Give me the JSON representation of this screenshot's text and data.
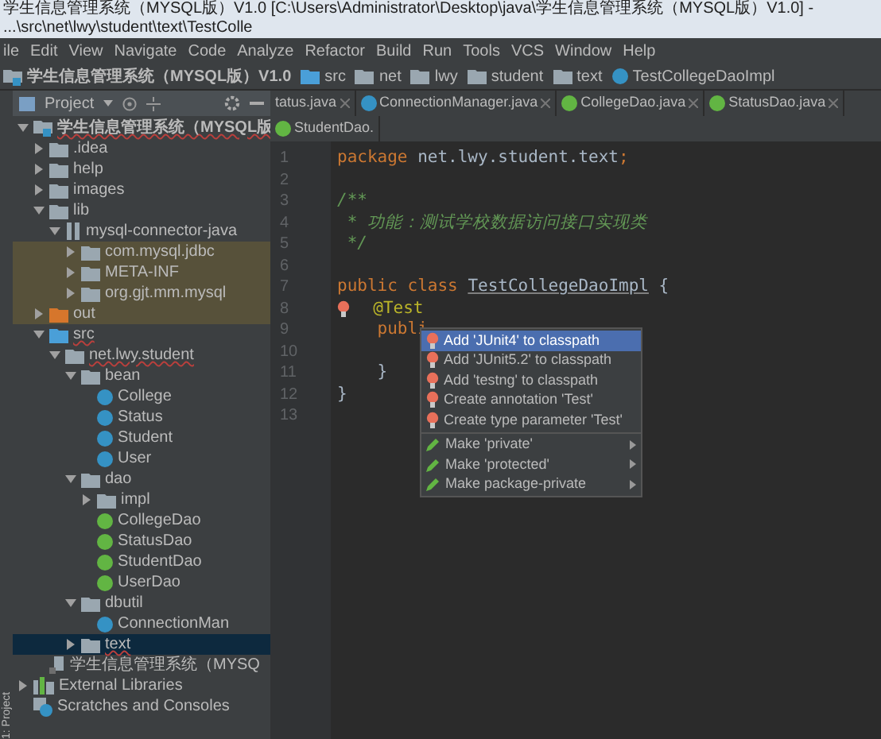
{
  "window": {
    "title": "学生信息管理系统（MYSQL版）V1.0 [C:\\Users\\Administrator\\Desktop\\java\\学生信息管理系统（MYSQL版）V1.0] - ...\\src\\net\\lwy\\student\\text\\TestColle"
  },
  "menu": [
    "ile",
    "Edit",
    "View",
    "Navigate",
    "Code",
    "Analyze",
    "Refactor",
    "Build",
    "Run",
    "Tools",
    "VCS",
    "Window",
    "Help"
  ],
  "breadcrumb": [
    {
      "text": "学生信息管理系统（MYSQL版）V1.0",
      "kind": "project"
    },
    {
      "text": "src",
      "kind": "source-folder"
    },
    {
      "text": "net",
      "kind": "folder"
    },
    {
      "text": "lwy",
      "kind": "folder"
    },
    {
      "text": "student",
      "kind": "folder"
    },
    {
      "text": "text",
      "kind": "folder"
    },
    {
      "text": "TestCollegeDaoImpl",
      "kind": "class"
    }
  ],
  "side_tab": "1: Project",
  "tool_window": {
    "title": "Project"
  },
  "tabs": [
    {
      "label": "tatus.java",
      "kind": "plain"
    },
    {
      "label": "ConnectionManager.java",
      "kind": "class"
    },
    {
      "label": "CollegeDao.java",
      "kind": "interface"
    },
    {
      "label": "StatusDao.java",
      "kind": "interface"
    },
    {
      "label": "StudentDao.",
      "kind": "interface"
    }
  ],
  "tree": [
    {
      "label": "学生信息管理系统（MYSQL版",
      "kind": "project",
      "expanded": true,
      "error": true,
      "children": [
        {
          "label": ".idea",
          "kind": "folder",
          "expanded": false
        },
        {
          "label": "help",
          "kind": "folder",
          "expanded": false
        },
        {
          "label": "images",
          "kind": "folder",
          "expanded": false
        },
        {
          "label": "lib",
          "kind": "folder",
          "expanded": true,
          "children": [
            {
              "label": "mysql-connector-java",
              "kind": "jar",
              "expanded": true,
              "children": [
                {
                  "label": "com.mysql.jdbc",
                  "kind": "package",
                  "expanded": false,
                  "tinted": true
                },
                {
                  "label": "META-INF",
                  "kind": "package",
                  "expanded": false,
                  "tinted": true
                },
                {
                  "label": "org.gjt.mm.mysql",
                  "kind": "package",
                  "expanded": false,
                  "tinted": true
                }
              ]
            }
          ]
        },
        {
          "label": "out",
          "kind": "output-folder",
          "expanded": false,
          "tinted": true
        },
        {
          "label": "src",
          "kind": "source-folder",
          "expanded": true,
          "error": true,
          "children": [
            {
              "label": "net.lwy.student",
              "kind": "package",
              "expanded": true,
              "error": true,
              "children": [
                {
                  "label": "bean",
                  "kind": "package",
                  "expanded": true,
                  "children": [
                    {
                      "label": "College",
                      "kind": "class"
                    },
                    {
                      "label": "Status",
                      "kind": "class"
                    },
                    {
                      "label": "Student",
                      "kind": "class"
                    },
                    {
                      "label": "User",
                      "kind": "class"
                    }
                  ]
                },
                {
                  "label": "dao",
                  "kind": "package",
                  "expanded": true,
                  "children": [
                    {
                      "label": "impl",
                      "kind": "package",
                      "expanded": false
                    },
                    {
                      "label": "CollegeDao",
                      "kind": "interface"
                    },
                    {
                      "label": "StatusDao",
                      "kind": "interface"
                    },
                    {
                      "label": "StudentDao",
                      "kind": "interface"
                    },
                    {
                      "label": "UserDao",
                      "kind": "interface"
                    }
                  ]
                },
                {
                  "label": "dbutil",
                  "kind": "package",
                  "expanded": true,
                  "children": [
                    {
                      "label": "ConnectionMan",
                      "kind": "class"
                    }
                  ]
                },
                {
                  "label": "text",
                  "kind": "package",
                  "expanded": false,
                  "selected": true,
                  "error": true
                }
              ]
            }
          ]
        },
        {
          "label": "学生信息管理系统（MYSQ",
          "kind": "module-file"
        }
      ]
    },
    {
      "label": "External Libraries",
      "kind": "libraries",
      "expanded": false
    },
    {
      "label": "Scratches and Consoles",
      "kind": "scratches"
    }
  ],
  "code": [
    {
      "number": "1",
      "tokens": [
        {
          "text": "package ",
          "kind": "keyword"
        },
        {
          "text": "net.lwy.student.text",
          "kind": "plain"
        },
        {
          "text": ";",
          "kind": "keyword"
        }
      ]
    },
    {
      "number": "2"
    },
    {
      "number": "3",
      "tokens": [
        {
          "text": "/**",
          "kind": "comment"
        }
      ]
    },
    {
      "number": "4",
      "tokens": [
        {
          "text": " * 功能：测试学校数据访问接口实现类",
          "kind": "comment"
        }
      ]
    },
    {
      "number": "5",
      "tokens": [
        {
          "text": " */",
          "kind": "comment"
        }
      ]
    },
    {
      "number": "6"
    },
    {
      "number": "7",
      "tokens": [
        {
          "text": "public class ",
          "kind": "keyword"
        },
        {
          "text": "TestCollegeDaoImpl",
          "kind": "class-name"
        },
        {
          "text": " {",
          "kind": "plain"
        }
      ]
    },
    {
      "number": "8",
      "bulb": true,
      "tokens": [
        {
          "text": "  @Test",
          "kind": "annotation"
        }
      ]
    },
    {
      "number": "9",
      "tokens": [
        {
          "text": "    publi",
          "kind": "keyword"
        }
      ]
    },
    {
      "number": "10"
    },
    {
      "number": "11",
      "tokens": [
        {
          "text": "    }",
          "kind": "plain"
        }
      ]
    },
    {
      "number": "12",
      "tokens": [
        {
          "text": "}",
          "kind": "plain"
        }
      ]
    },
    {
      "number": "13"
    }
  ],
  "popup": [
    {
      "label": "Add 'JUnit4' to classpath",
      "kind": "intention",
      "selected": true,
      "submenu": false
    },
    {
      "label": "Add 'JUnit5.2' to classpath",
      "kind": "intention",
      "selected": false,
      "submenu": false
    },
    {
      "label": "Add 'testng' to classpath",
      "kind": "intention",
      "selected": false,
      "submenu": false
    },
    {
      "label": "Create annotation 'Test'",
      "kind": "intention",
      "selected": false,
      "submenu": false
    },
    {
      "label": "Create type parameter 'Test'",
      "kind": "intention",
      "selected": false,
      "submenu": false
    },
    {
      "label": "Make 'private'",
      "kind": "refactor",
      "selected": false,
      "submenu": true
    },
    {
      "label": "Make 'protected'",
      "kind": "refactor",
      "selected": false,
      "submenu": true
    },
    {
      "label": "Make package-private",
      "kind": "refactor",
      "selected": false,
      "submenu": true
    }
  ]
}
